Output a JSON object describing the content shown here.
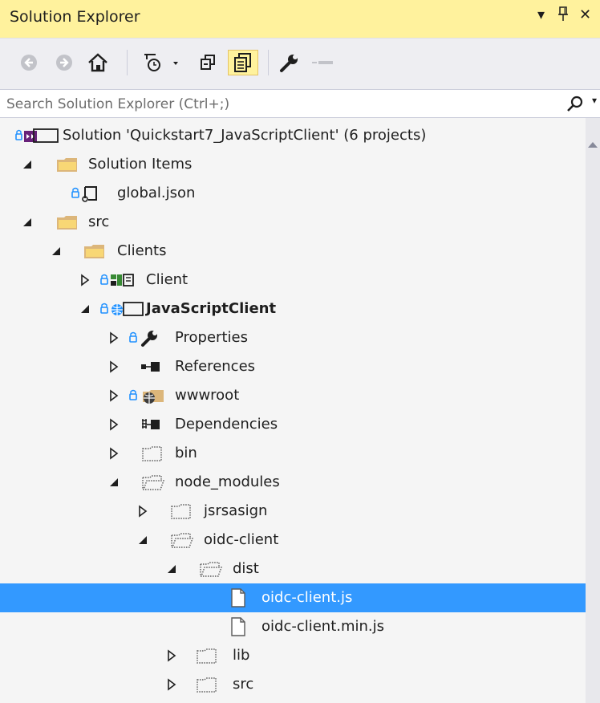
{
  "titlebar": {
    "title": "Solution Explorer",
    "dropdown_glyph": "▾",
    "pin_glyph": "ᛘ",
    "close_glyph": "✕"
  },
  "toolbar": {
    "buttons": [
      "back-icon",
      "forward-icon",
      "home-icon",
      "pending-changes-filter-icon",
      "collapse-all-icon",
      "show-all-files-icon",
      "properties-icon",
      "preview-icon"
    ]
  },
  "search": {
    "placeholder": "Search Solution Explorer (Ctrl+;)",
    "caret": "▾"
  },
  "tree": {
    "rows": [
      {
        "label": "Solution 'Quickstart7_JavaScriptClient' (6 projects)",
        "icon": "solution-icon",
        "expander": "none"
      },
      {
        "label": "Solution Items",
        "icon": "folder-icon",
        "expander": "expanded"
      },
      {
        "label": "global.json",
        "icon": "json-file-icon",
        "expander": "none"
      },
      {
        "label": "src",
        "icon": "folder-icon",
        "expander": "expanded"
      },
      {
        "label": "Clients",
        "icon": "folder-icon",
        "expander": "expanded"
      },
      {
        "label": "Client",
        "icon": "project-icon",
        "expander": "collapsed"
      },
      {
        "label": "JavaScriptClient",
        "icon": "web-project-icon",
        "expander": "expanded",
        "bold": true
      },
      {
        "label": "Properties",
        "icon": "wrench-icon",
        "expander": "collapsed"
      },
      {
        "label": "References",
        "icon": "references-icon",
        "expander": "collapsed"
      },
      {
        "label": "wwwroot",
        "icon": "web-folder-icon",
        "expander": "collapsed"
      },
      {
        "label": "Dependencies",
        "icon": "dependencies-icon",
        "expander": "collapsed"
      },
      {
        "label": "bin",
        "icon": "hidden-folder-icon",
        "expander": "collapsed"
      },
      {
        "label": "node_modules",
        "icon": "hidden-folder-open-icon",
        "expander": "expanded"
      },
      {
        "label": "jsrsasign",
        "icon": "hidden-folder-icon",
        "expander": "collapsed"
      },
      {
        "label": "oidc-client",
        "icon": "hidden-folder-open-icon",
        "expander": "expanded"
      },
      {
        "label": "dist",
        "icon": "hidden-folder-open-icon",
        "expander": "expanded"
      },
      {
        "label": "oidc-client.js",
        "icon": "file-icon",
        "expander": "none",
        "selected": true
      },
      {
        "label": "oidc-client.min.js",
        "icon": "file-icon",
        "expander": "none"
      },
      {
        "label": "lib",
        "icon": "hidden-folder-icon",
        "expander": "collapsed"
      },
      {
        "label": "src",
        "icon": "hidden-folder-icon",
        "expander": "collapsed"
      }
    ]
  },
  "colors": {
    "title_bg": "#fff29d",
    "selection": "#3399ff",
    "panel_bg": "#f5f5f5",
    "lock_blue": "#1e90ff"
  }
}
